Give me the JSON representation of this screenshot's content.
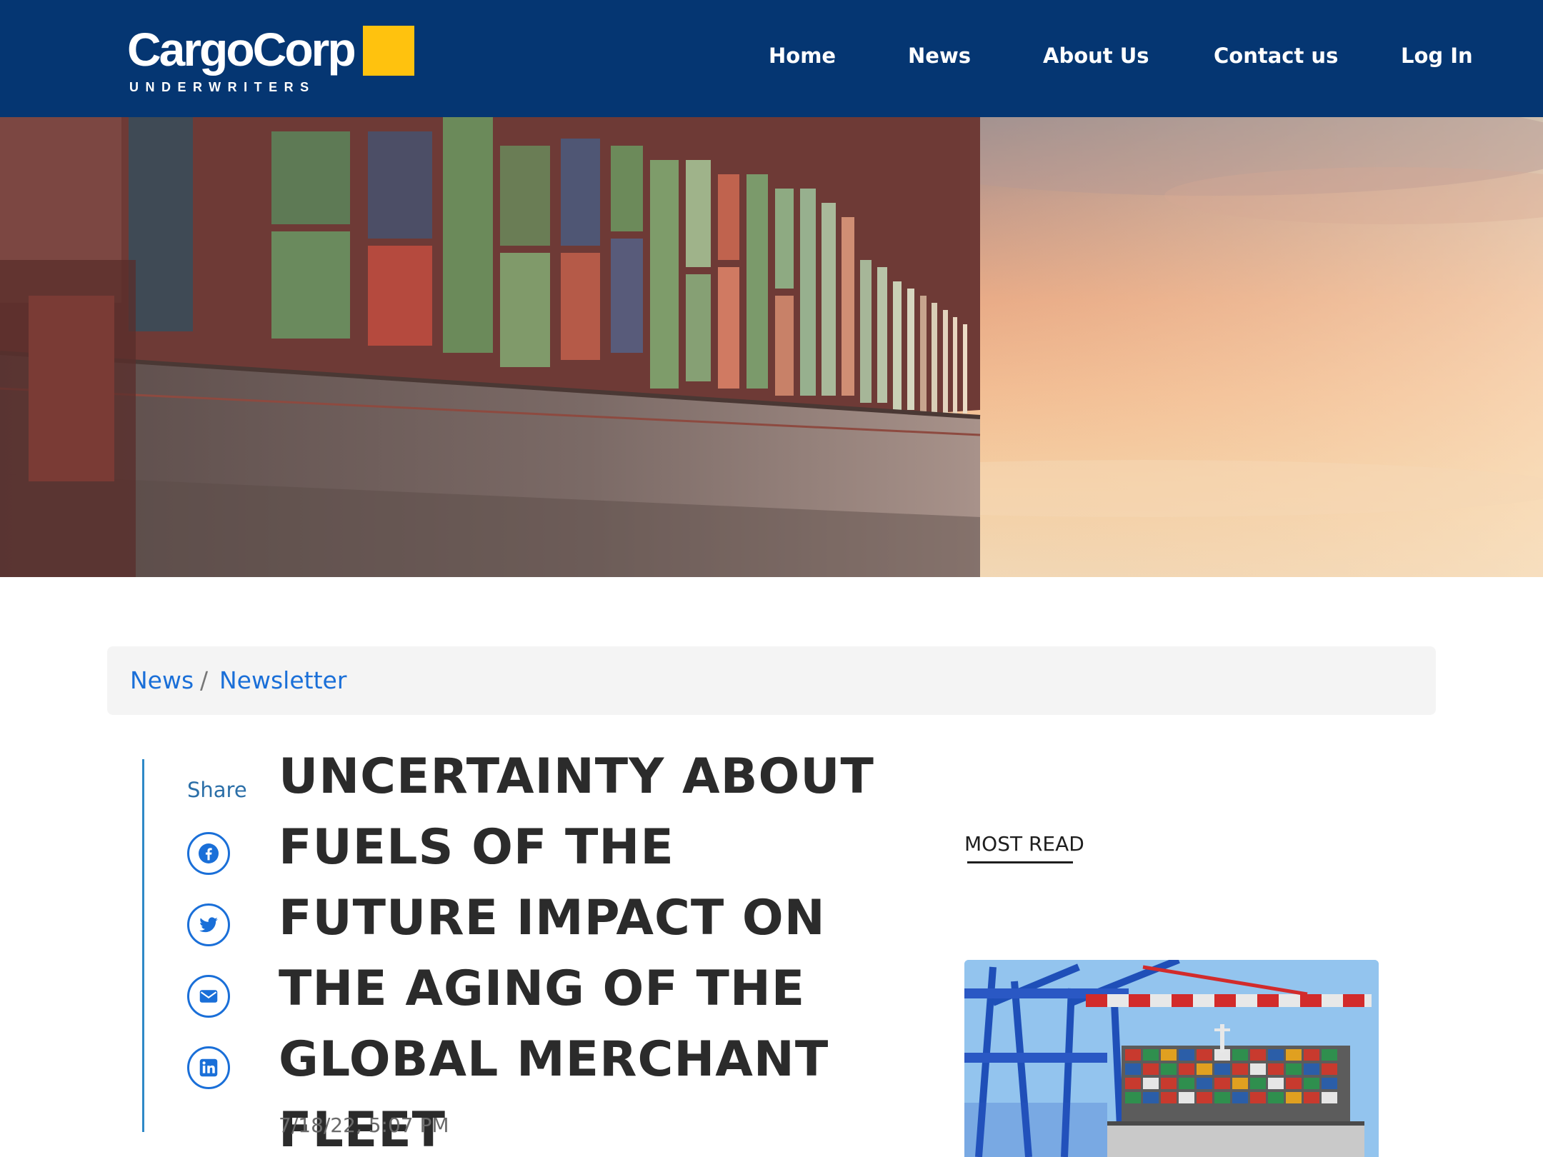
{
  "brand": {
    "name": "CargoCorp",
    "subtitle": "UNDERWRITERS",
    "accent_color": "#ffc20e",
    "header_color": "#053672"
  },
  "nav": {
    "items": [
      {
        "label": "Home"
      },
      {
        "label": "News"
      },
      {
        "label": "About Us"
      },
      {
        "label": "Contact us"
      },
      {
        "label": "Log In"
      }
    ]
  },
  "breadcrumb": {
    "items": [
      {
        "label": "News"
      },
      {
        "label": "Newsletter"
      }
    ],
    "separator": "/"
  },
  "share": {
    "label": "Share",
    "icons": [
      "facebook-icon",
      "twitter-icon",
      "email-icon",
      "linkedin-icon"
    ]
  },
  "article": {
    "title": "UNCERTAINTY ABOUT FUELS OF THE FUTURE IMPACT ON THE AGING OF THE GLOBAL MERCHANT FLEET",
    "date": "7/18/22, 5:07 PM"
  },
  "sidebar": {
    "most_read_label": "MOST READ"
  }
}
